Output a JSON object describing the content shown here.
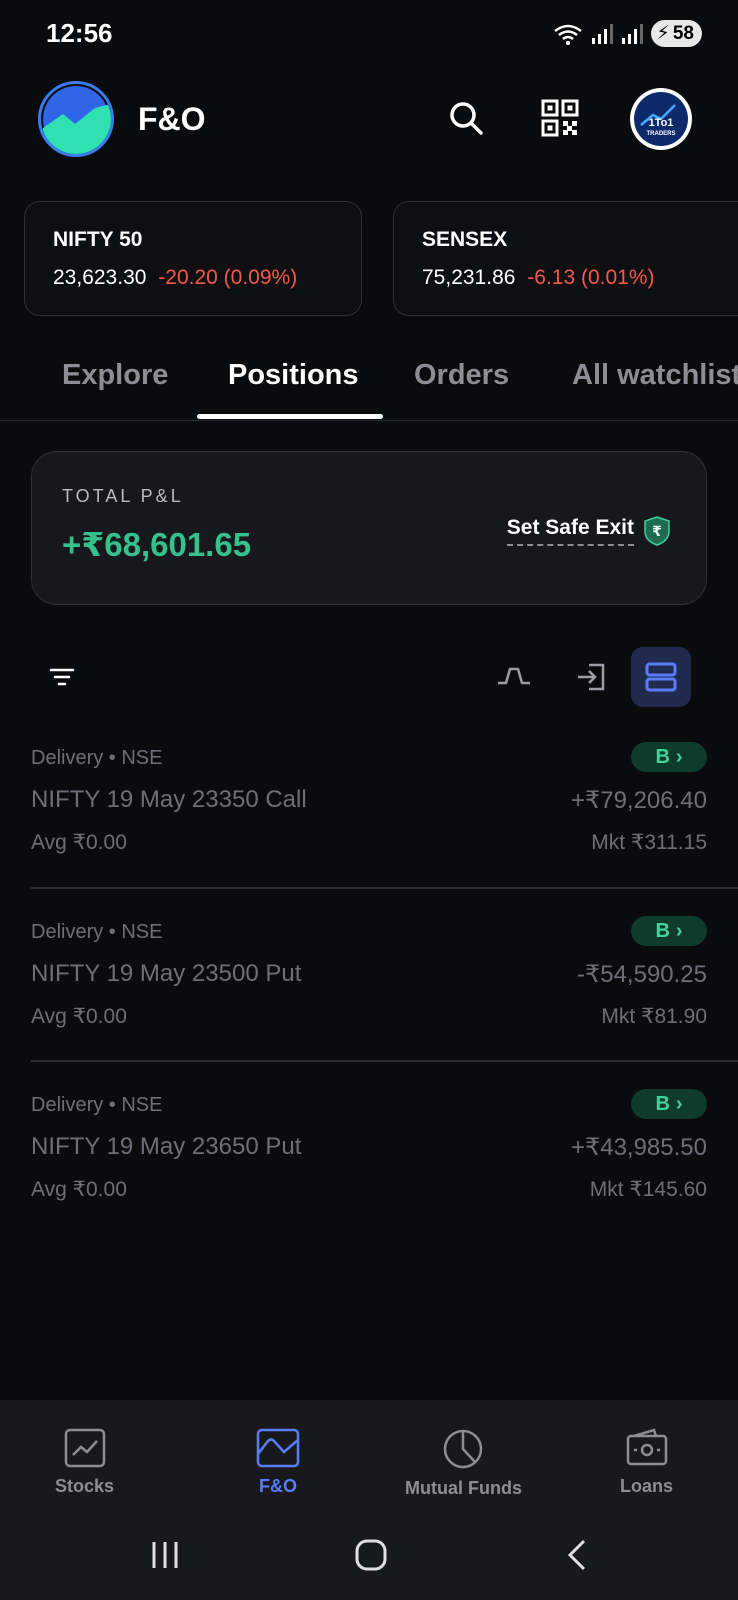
{
  "status_bar": {
    "time": "12:56",
    "battery": "58"
  },
  "header": {
    "title": "F&O",
    "avatar_text": "1To1",
    "avatar_subtext": "TRADERS"
  },
  "indices": [
    {
      "name": "NIFTY 50",
      "price": "23,623.30",
      "change": "-20.20 (0.09%)"
    },
    {
      "name": "SENSEX",
      "price": "75,231.86",
      "change": "-6.13 (0.01%)"
    }
  ],
  "tabs": [
    {
      "label": "Explore"
    },
    {
      "label": "Positions"
    },
    {
      "label": "Orders"
    },
    {
      "label": "All watchlists"
    }
  ],
  "active_tab": "Positions",
  "summary": {
    "label": "TOTAL P&L",
    "value": "+₹68,601.65",
    "safe_exit_label": "Set Safe Exit"
  },
  "positions": [
    {
      "meta": "Delivery • NSE",
      "name": "NIFTY 19 May 23350 Call",
      "avg": "Avg ₹0.00",
      "pnl": "+₹79,206.40",
      "mkt": "Mkt ₹311.15",
      "badge": "B"
    },
    {
      "meta": "Delivery • NSE",
      "name": "NIFTY 19 May 23500 Put",
      "avg": "Avg ₹0.00",
      "pnl": "-₹54,590.25",
      "mkt": "Mkt ₹81.90",
      "badge": "B"
    },
    {
      "meta": "Delivery • NSE",
      "name": "NIFTY 19 May 23650 Put",
      "avg": "Avg ₹0.00",
      "pnl": "+₹43,985.50",
      "mkt": "Mkt ₹145.60",
      "badge": "B"
    }
  ],
  "bottom_nav": [
    {
      "label": "Stocks",
      "icon": "chart-line-icon"
    },
    {
      "label": "F&O",
      "icon": "fno-chart-icon"
    },
    {
      "label": "Mutual Funds",
      "icon": "pie-chart-icon"
    },
    {
      "label": "Loans",
      "icon": "banknote-icon"
    }
  ],
  "active_nav": "F&O",
  "colors": {
    "background": "#0a0b0d",
    "positive": "#35c08c",
    "negative": "#f15a4a",
    "accent": "#5b7cfa"
  }
}
